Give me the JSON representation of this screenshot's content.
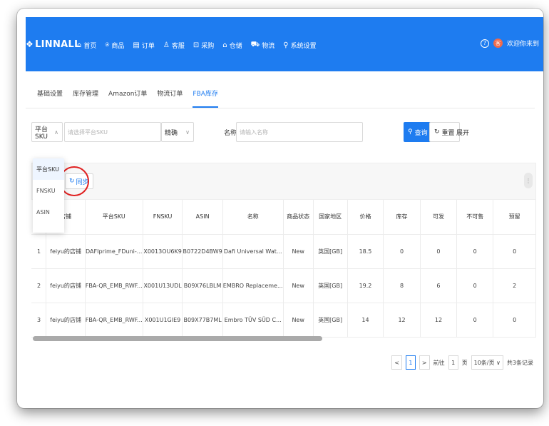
{
  "app": {
    "logo_mark": "❖",
    "logo_text": "LINNALL"
  },
  "nav": [
    {
      "icon": "⌂",
      "icon_name": "home-icon",
      "label": "首页"
    },
    {
      "icon": "⍟",
      "icon_name": "product-icon",
      "label": "商品"
    },
    {
      "icon": "▤",
      "icon_name": "order-icon",
      "label": "订单"
    },
    {
      "icon": "♙",
      "icon_name": "customer-icon",
      "label": "客服"
    },
    {
      "icon": "⊡",
      "icon_name": "purchase-icon",
      "label": "采购"
    },
    {
      "icon": "⌂",
      "icon_name": "warehouse-icon",
      "label": "仓储"
    },
    {
      "icon": "⛟",
      "icon_name": "logistics-icon",
      "label": "物流"
    },
    {
      "icon": "⚲",
      "icon_name": "settings-icon",
      "label": "系统设置"
    }
  ],
  "topright": {
    "help_icon": "?",
    "avatar_text": "客",
    "greeting": "欢迎你来到"
  },
  "tabs": [
    "基础设置",
    "库存管理",
    "Amazon订单",
    "物流订单",
    "FBA库存"
  ],
  "active_tab": 4,
  "search": {
    "type_value": "平台SKU",
    "input_placeholder": "请选择平台SKU",
    "precise_value": "精确",
    "name_label": "名称:",
    "name_placeholder": "请输入名称",
    "query_label": "查询",
    "reset_label": "重置",
    "expand_label": "展开"
  },
  "dropdown_options": [
    "平台SKU",
    "FNSKU",
    "ASIN"
  ],
  "toolbar": {
    "sync_label": "同步"
  },
  "columns": [
    "",
    "店铺",
    "平台SKU",
    "FNSKU",
    "ASIN",
    "名称",
    "商品状态",
    "国家地区",
    "价格",
    "库存",
    "可发",
    "不可售",
    "预留"
  ],
  "rows": [
    [
      "1",
      "feiyu的店铺",
      "DAFIprime_FDuni-...",
      "X0013OU6K9",
      "B0722D4BW9",
      "Dafi Universal Wat...",
      "New",
      "英国[GB]",
      "18.5",
      "0",
      "0",
      "0",
      "0"
    ],
    [
      "2",
      "feiyu的店铺",
      "FBA-QR_EMB_RWF...",
      "X001U13UDL",
      "B09X76LBLM",
      "EMBRO Replaceme...",
      "New",
      "英国[GB]",
      "19.2",
      "8",
      "6",
      "0",
      "2"
    ],
    [
      "3",
      "feiyu的店铺",
      "FBA-QR_EMB_RWF...",
      "X001U1GIE9",
      "B09X77B7ML",
      "Embro TÜV SÜD C...",
      "New",
      "英国[GB]",
      "14",
      "12",
      "12",
      "0",
      "0"
    ]
  ],
  "pager": {
    "prev": "<",
    "page": "1",
    "next": ">",
    "goto": "前往",
    "goto_value": "1",
    "page_unit": "页",
    "per_page": "10条/页",
    "total": "共3条记录"
  }
}
